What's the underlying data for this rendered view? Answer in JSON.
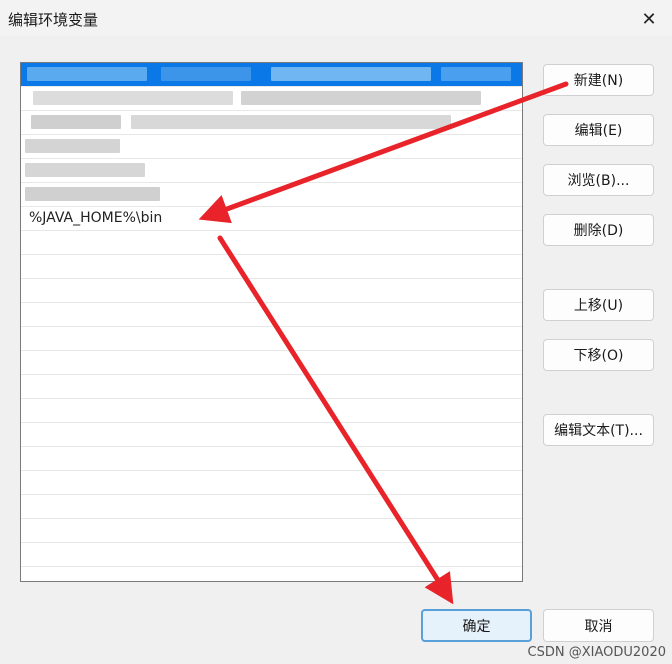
{
  "window": {
    "title": "编辑环境变量",
    "close_symbol": "✕"
  },
  "list": {
    "visible_entry": "%JAVA_HOME%\\bin",
    "empty_rows": 15
  },
  "buttons": {
    "new": "新建(N)",
    "edit": "编辑(E)",
    "browse": "浏览(B)...",
    "delete": "删除(D)",
    "move_up": "上移(U)",
    "move_down": "下移(O)",
    "edit_text": "编辑文本(T)...",
    "ok": "确定",
    "cancel": "取消"
  },
  "watermark": "CSDN @XIAODU2020",
  "colors": {
    "selection": "#0a78e6",
    "annotation_arrow": "#e8232a",
    "ok_border": "#5aa0d8"
  }
}
